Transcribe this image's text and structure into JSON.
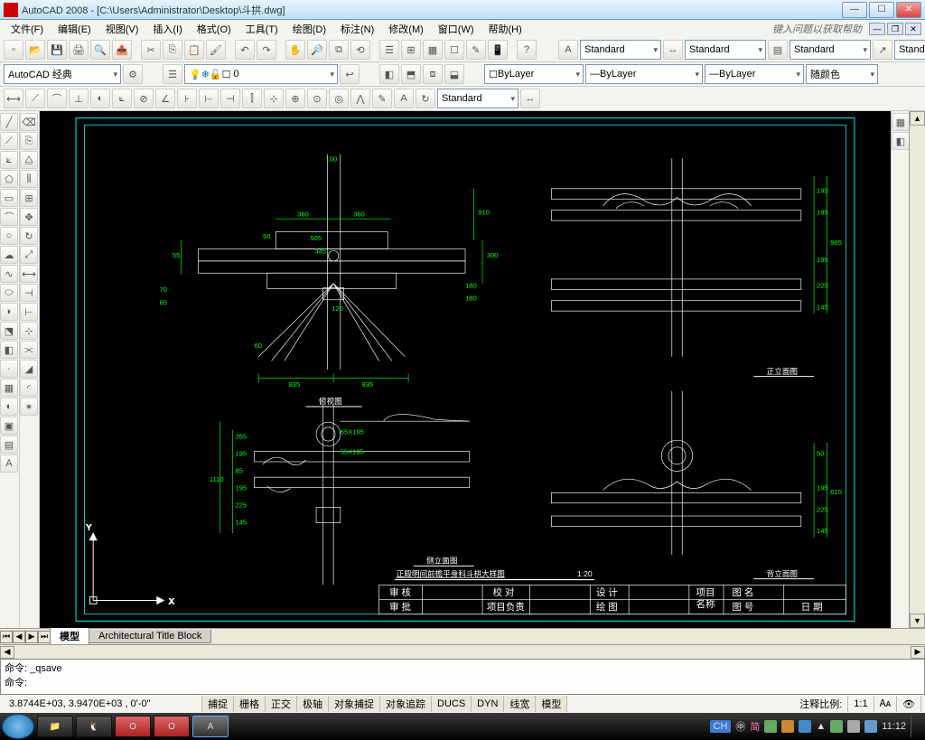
{
  "window": {
    "title": "AutoCAD 2008 - [C:\\Users\\Administrator\\Desktop\\斗拱.dwg]"
  },
  "menubar": {
    "items": [
      "文件(F)",
      "编辑(E)",
      "视图(V)",
      "插入(I)",
      "格式(O)",
      "工具(T)",
      "绘图(D)",
      "标注(N)",
      "修改(M)",
      "窗口(W)",
      "帮助(H)"
    ],
    "help_hint": "键入问题以获取帮助"
  },
  "style_row": {
    "text_style": "Standard",
    "dim_style": "Standard",
    "table_style": "Standard",
    "ml_style": "Standard"
  },
  "layer_row": {
    "workspace": "AutoCAD 经典",
    "layer_state": "",
    "bylayer1": "ByLayer",
    "bylayer2": "ByLayer",
    "bylayer3": "ByLayer",
    "color": "随颜色"
  },
  "dim_toolbar_style": "Standard",
  "tabs": {
    "active": "模型",
    "other": "Architectural Title Block"
  },
  "commandline": {
    "line1": "命令: _qsave",
    "line2": "命令:"
  },
  "statusbar": {
    "coords": "3.8744E+03,  3.9470E+03 , 0'-0\"",
    "toggles": [
      "捕捉",
      "栅格",
      "正交",
      "极轴",
      "对象捕捉",
      "对象追踪",
      "DUCS",
      "DYN",
      "线宽",
      "模型"
    ],
    "annoscale_label": "注释比例:",
    "annoscale": "1:1"
  },
  "taskbar": {
    "ime": "CH",
    "time": "11:12"
  },
  "drawing": {
    "main_title": "正殿明间前檐平身科斗栱大样图",
    "main_scale": "1:20",
    "view_top_left": "俯视图",
    "view_bottom_left": "侧立面图",
    "view_top_right": "正立面图",
    "view_bottom_right": "背立面图",
    "tb_shenhe": "审 核",
    "tb_shenpi": "审 批",
    "tb_xiaodui": "校 对",
    "tb_xmfz": "项目负责",
    "tb_sheji": "设 计",
    "tb_huitu": "绘 图",
    "tb_xmmc": "项目\n名称",
    "tb_tuming": "图 名",
    "tb_tuhao": "图 号",
    "tb_riqi": "日 期",
    "d835a": "835",
    "d835b": "835",
    "d360a": "360",
    "d360b": "360",
    "d100": "100",
    "d910": "910",
    "d300": "300",
    "d180": "180",
    "d120": "120",
    "d55": "55",
    "d70": "70",
    "d65": "65",
    "d50": "50",
    "d60": "60",
    "d505": "505",
    "d345": "345",
    "d1110": "1110",
    "d145": "145",
    "d225": "225",
    "d195": "195",
    "d265": "265",
    "d65x195": "65X195",
    "d55x195": "55X195",
    "d965": "965",
    "d615": "615",
    "d85": "85"
  }
}
